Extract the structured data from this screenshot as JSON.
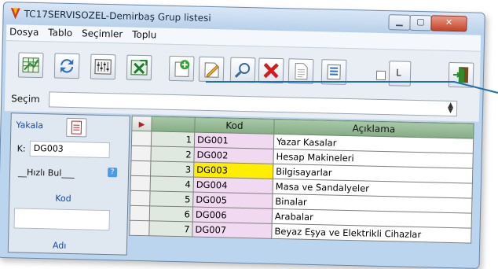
{
  "window": {
    "title": "TC17SERVISOZEL-Demirbaş Grup listesi"
  },
  "menu": [
    "Dosya",
    "Tablo",
    "Seçimler",
    "Toplu"
  ],
  "toolbar": {
    "buttons": [
      {
        "name": "spreadsheet-icon"
      },
      {
        "name": "refresh-icon"
      },
      {
        "name": "equalizer-icon"
      },
      {
        "name": "excel-export-icon"
      },
      {
        "name": "add-record-icon"
      },
      {
        "name": "edit-record-icon"
      },
      {
        "name": "search-icon"
      },
      {
        "name": "delete-icon"
      },
      {
        "name": "document-icon"
      },
      {
        "name": "list-settings-icon"
      },
      {
        "name": "label-icon"
      },
      {
        "name": "exit-door-icon"
      }
    ],
    "label_button_text": "L"
  },
  "secim": {
    "label": "Seçim",
    "value": ""
  },
  "left_panel": {
    "yakala_label": "Yakala",
    "k_label": "K:",
    "k_value": "DG003",
    "hizli_bul_label": "__Hızlı Bul___",
    "help_label": "?",
    "kod_label": "Kod",
    "adi_label": "Adı"
  },
  "grid": {
    "columns": [
      "Kod",
      "Açıklama"
    ],
    "selected_row": 3,
    "rows": [
      {
        "no": "1",
        "kod": "DG001",
        "aciklama": "Yazar Kasalar"
      },
      {
        "no": "2",
        "kod": "DG002",
        "aciklama": "Hesap Makineleri"
      },
      {
        "no": "3",
        "kod": "DG003",
        "aciklama": "Bilgisayarlar"
      },
      {
        "no": "4",
        "kod": "DG004",
        "aciklama": "Masa ve Sandalyeler"
      },
      {
        "no": "5",
        "kod": "DG005",
        "aciklama": "Binalar"
      },
      {
        "no": "6",
        "kod": "DG006",
        "aciklama": "Arabalar"
      },
      {
        "no": "7",
        "kod": "DG007",
        "aciklama": "Beyaz Eşya ve Elektrikli Cihazlar"
      }
    ]
  },
  "colors": {
    "accent": "#1f6fb3",
    "selected_row": "#ffee00",
    "kod_cell": "#f2d9f2",
    "header": "#8fb48f"
  }
}
